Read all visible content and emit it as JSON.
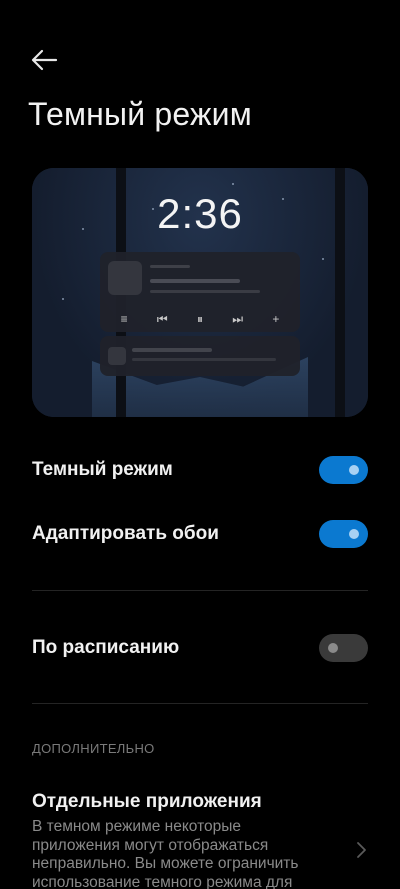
{
  "header": {
    "title": "Темный режим"
  },
  "preview": {
    "clock": "2:36",
    "player_controls": [
      "≡",
      "⏮",
      "⏸",
      "⏭",
      "+"
    ]
  },
  "settings": {
    "dark_mode": {
      "label": "Темный режим",
      "on": true
    },
    "adapt_wallpaper": {
      "label": "Адаптировать обои",
      "on": true
    },
    "schedule": {
      "label": "По расписанию",
      "on": false
    }
  },
  "advanced": {
    "section_label": "ДОПОЛНИТЕЛЬНО",
    "apps_title": "Отдельные приложения",
    "apps_description": "В темном режиме некоторые приложения могут отображаться неправильно. Вы можете ограничить использование темного режима для"
  },
  "colors": {
    "accent": "#0b79d0",
    "background": "#000000",
    "toggle_off": "#3a3a3a"
  },
  "icons": {
    "back": "arrow-left-icon",
    "chevron": "chevron-right-icon"
  }
}
